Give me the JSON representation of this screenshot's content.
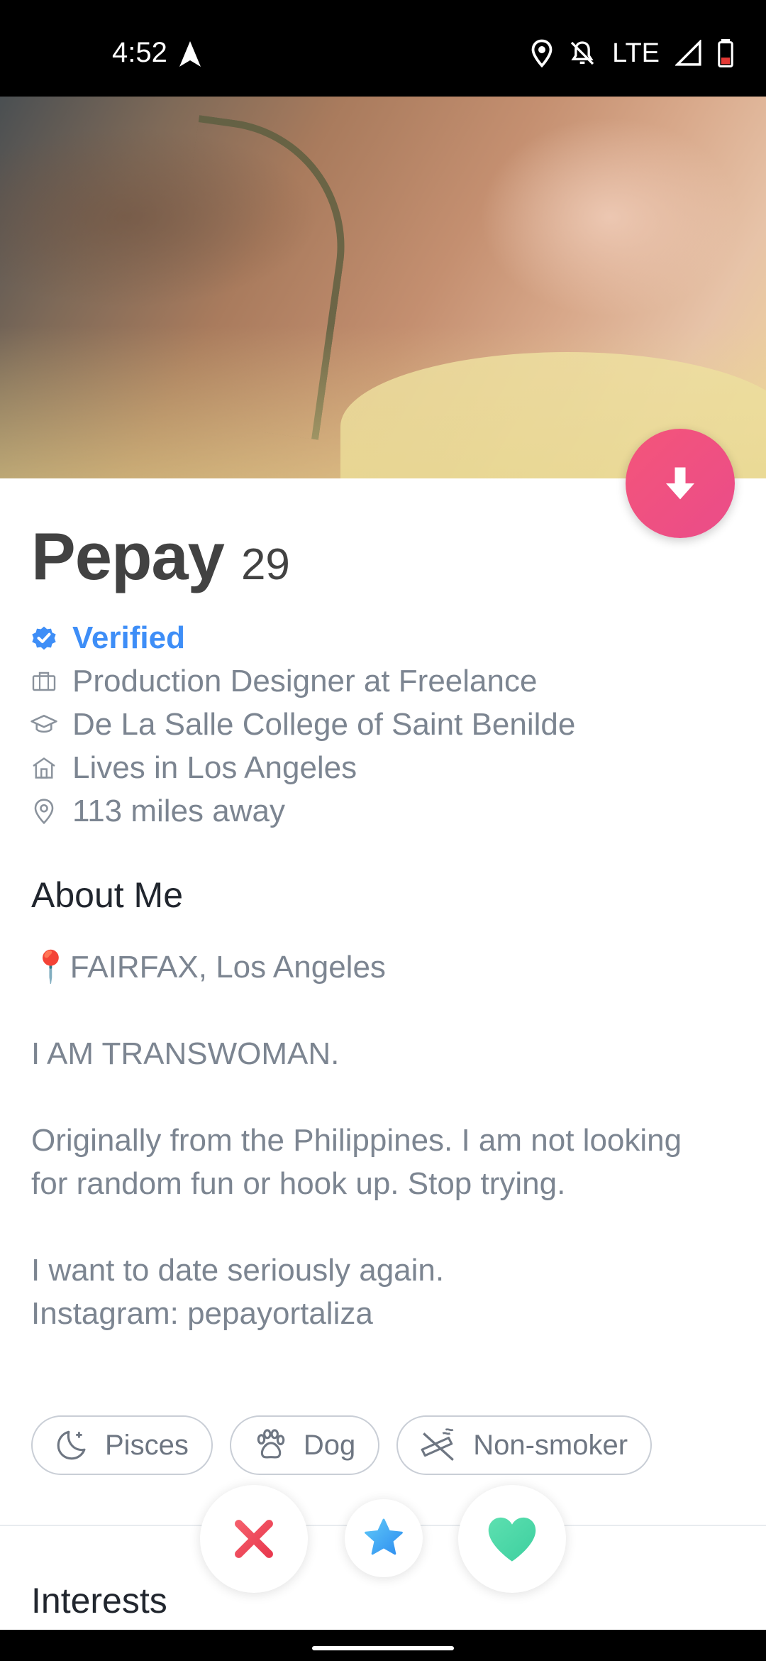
{
  "status_bar": {
    "time": "4:52",
    "network": "LTE",
    "icons": [
      "navigation-icon",
      "location-icon",
      "notifications-off-icon",
      "signal-icon",
      "battery-icon"
    ]
  },
  "profile": {
    "name": "Pepay",
    "age": "29",
    "verified_label": "Verified",
    "job": "Production Designer at Freelance",
    "school": "De La Salle College of Saint Benilde",
    "lives_in": "Lives in Los Angeles",
    "distance": "113 miles away"
  },
  "about": {
    "title": "About Me",
    "location_line": "FAIRFAX, Los Angeles",
    "location_emoji": "📍",
    "line_1": "I AM TRANSWOMAN.",
    "line_2": "Originally from the Philippines. I am not looking for random fun or hook up. Stop trying.",
    "line_3a": "I want to date seriously again.",
    "line_3b": "Instagram: pepayortaliza"
  },
  "chips": [
    {
      "label": "Pisces",
      "icon": "moon-icon"
    },
    {
      "label": "Dog",
      "icon": "paw-icon"
    },
    {
      "label": "Non-smoker",
      "icon": "no-smoking-icon"
    }
  ],
  "interests": {
    "title": "Interests"
  },
  "colors": {
    "accent_pink": "#ea4c89",
    "verified_blue": "#3e8ef7",
    "nope_red": "#e94057",
    "super_like_blue": "#3fa9f5",
    "like_green": "#4fd9a7"
  }
}
